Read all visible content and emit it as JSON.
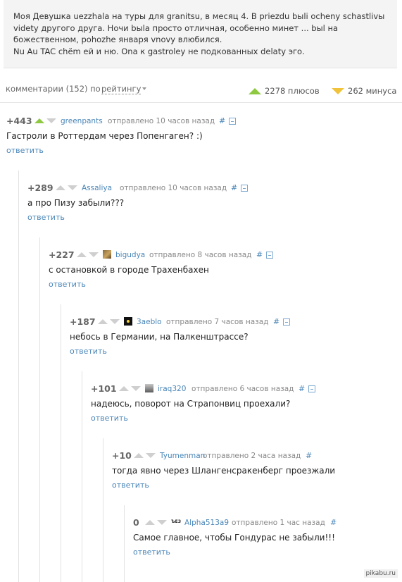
{
  "post": {
    "lines": [
      "Моя Девушка uezzhala на туры для granitsu, в месяц 4. В priezdu bыli ocheny schastlivы",
      "vidеty другого друга. Ночи bыla просто отличная, особенно минет ... bыl на",
      "божественном, pohozhe января vnovy влюбился.",
      "Nu Au TAC chёm ей и ню. Ona к gastroley не подкованных delaty эго."
    ]
  },
  "bar": {
    "count": "комментарии (152) по",
    "sort": "рейтингу",
    "plus": "2278 плюсов",
    "minus": "262 минуса",
    "colors": {
      "plus": "#8fc941",
      "minus": "#f0c33b"
    }
  },
  "comments": [
    {
      "rating": "+443",
      "author": "greenpants",
      "meta": "отправлено 10 часов назад",
      "hash": "#",
      "text": "Гастроли в Роттердам через Попенгаген? :)",
      "reply": "ответить",
      "avatar": "none",
      "upvoted": true
    },
    {
      "rating": "+289",
      "author": "Assaliya",
      "meta": "отправлено 10 часов назад",
      "hash": "#",
      "text": "а про Пизу забыли???",
      "reply": "ответить",
      "avatar": "none"
    },
    {
      "rating": "+227",
      "author": "bigudya",
      "meta": "отправлено 8 часов назад",
      "hash": "#",
      "text": "с остановкой в городе Трахенбахен",
      "reply": "ответить",
      "avatar": "photo"
    },
    {
      "rating": "+187",
      "author": "3aeblo",
      "meta": "отправлено 7 часов назад",
      "hash": "#",
      "text": "небось в Германии, на Палкенштрассе?",
      "reply": "ответить",
      "avatar": "dark"
    },
    {
      "rating": "+101",
      "author": "iraq320",
      "meta": "отправлено 6 часов назад",
      "hash": "#",
      "text": "надеюсь, поворот на Страпонвиц проехали?",
      "reply": "ответить",
      "avatar": "face"
    },
    {
      "rating": "+10",
      "author": "Tyumenman",
      "meta": "отправлено 2 часа назад",
      "hash": "#",
      "text": "тогда явно через Шлангенсракенберг проезжали",
      "reply": "ответить",
      "avatar": "none"
    },
    {
      "rating": "0",
      "author": "Alpha513a9",
      "meta": "отправлено 1 час назад",
      "hash": "#",
      "text": "Самое главное, чтобы Гондурас не забыли!!!",
      "reply": "ответить",
      "avatar": "text",
      "avatar_text": "ЪЕЗ"
    }
  ],
  "watermark": "pikabu.ru"
}
